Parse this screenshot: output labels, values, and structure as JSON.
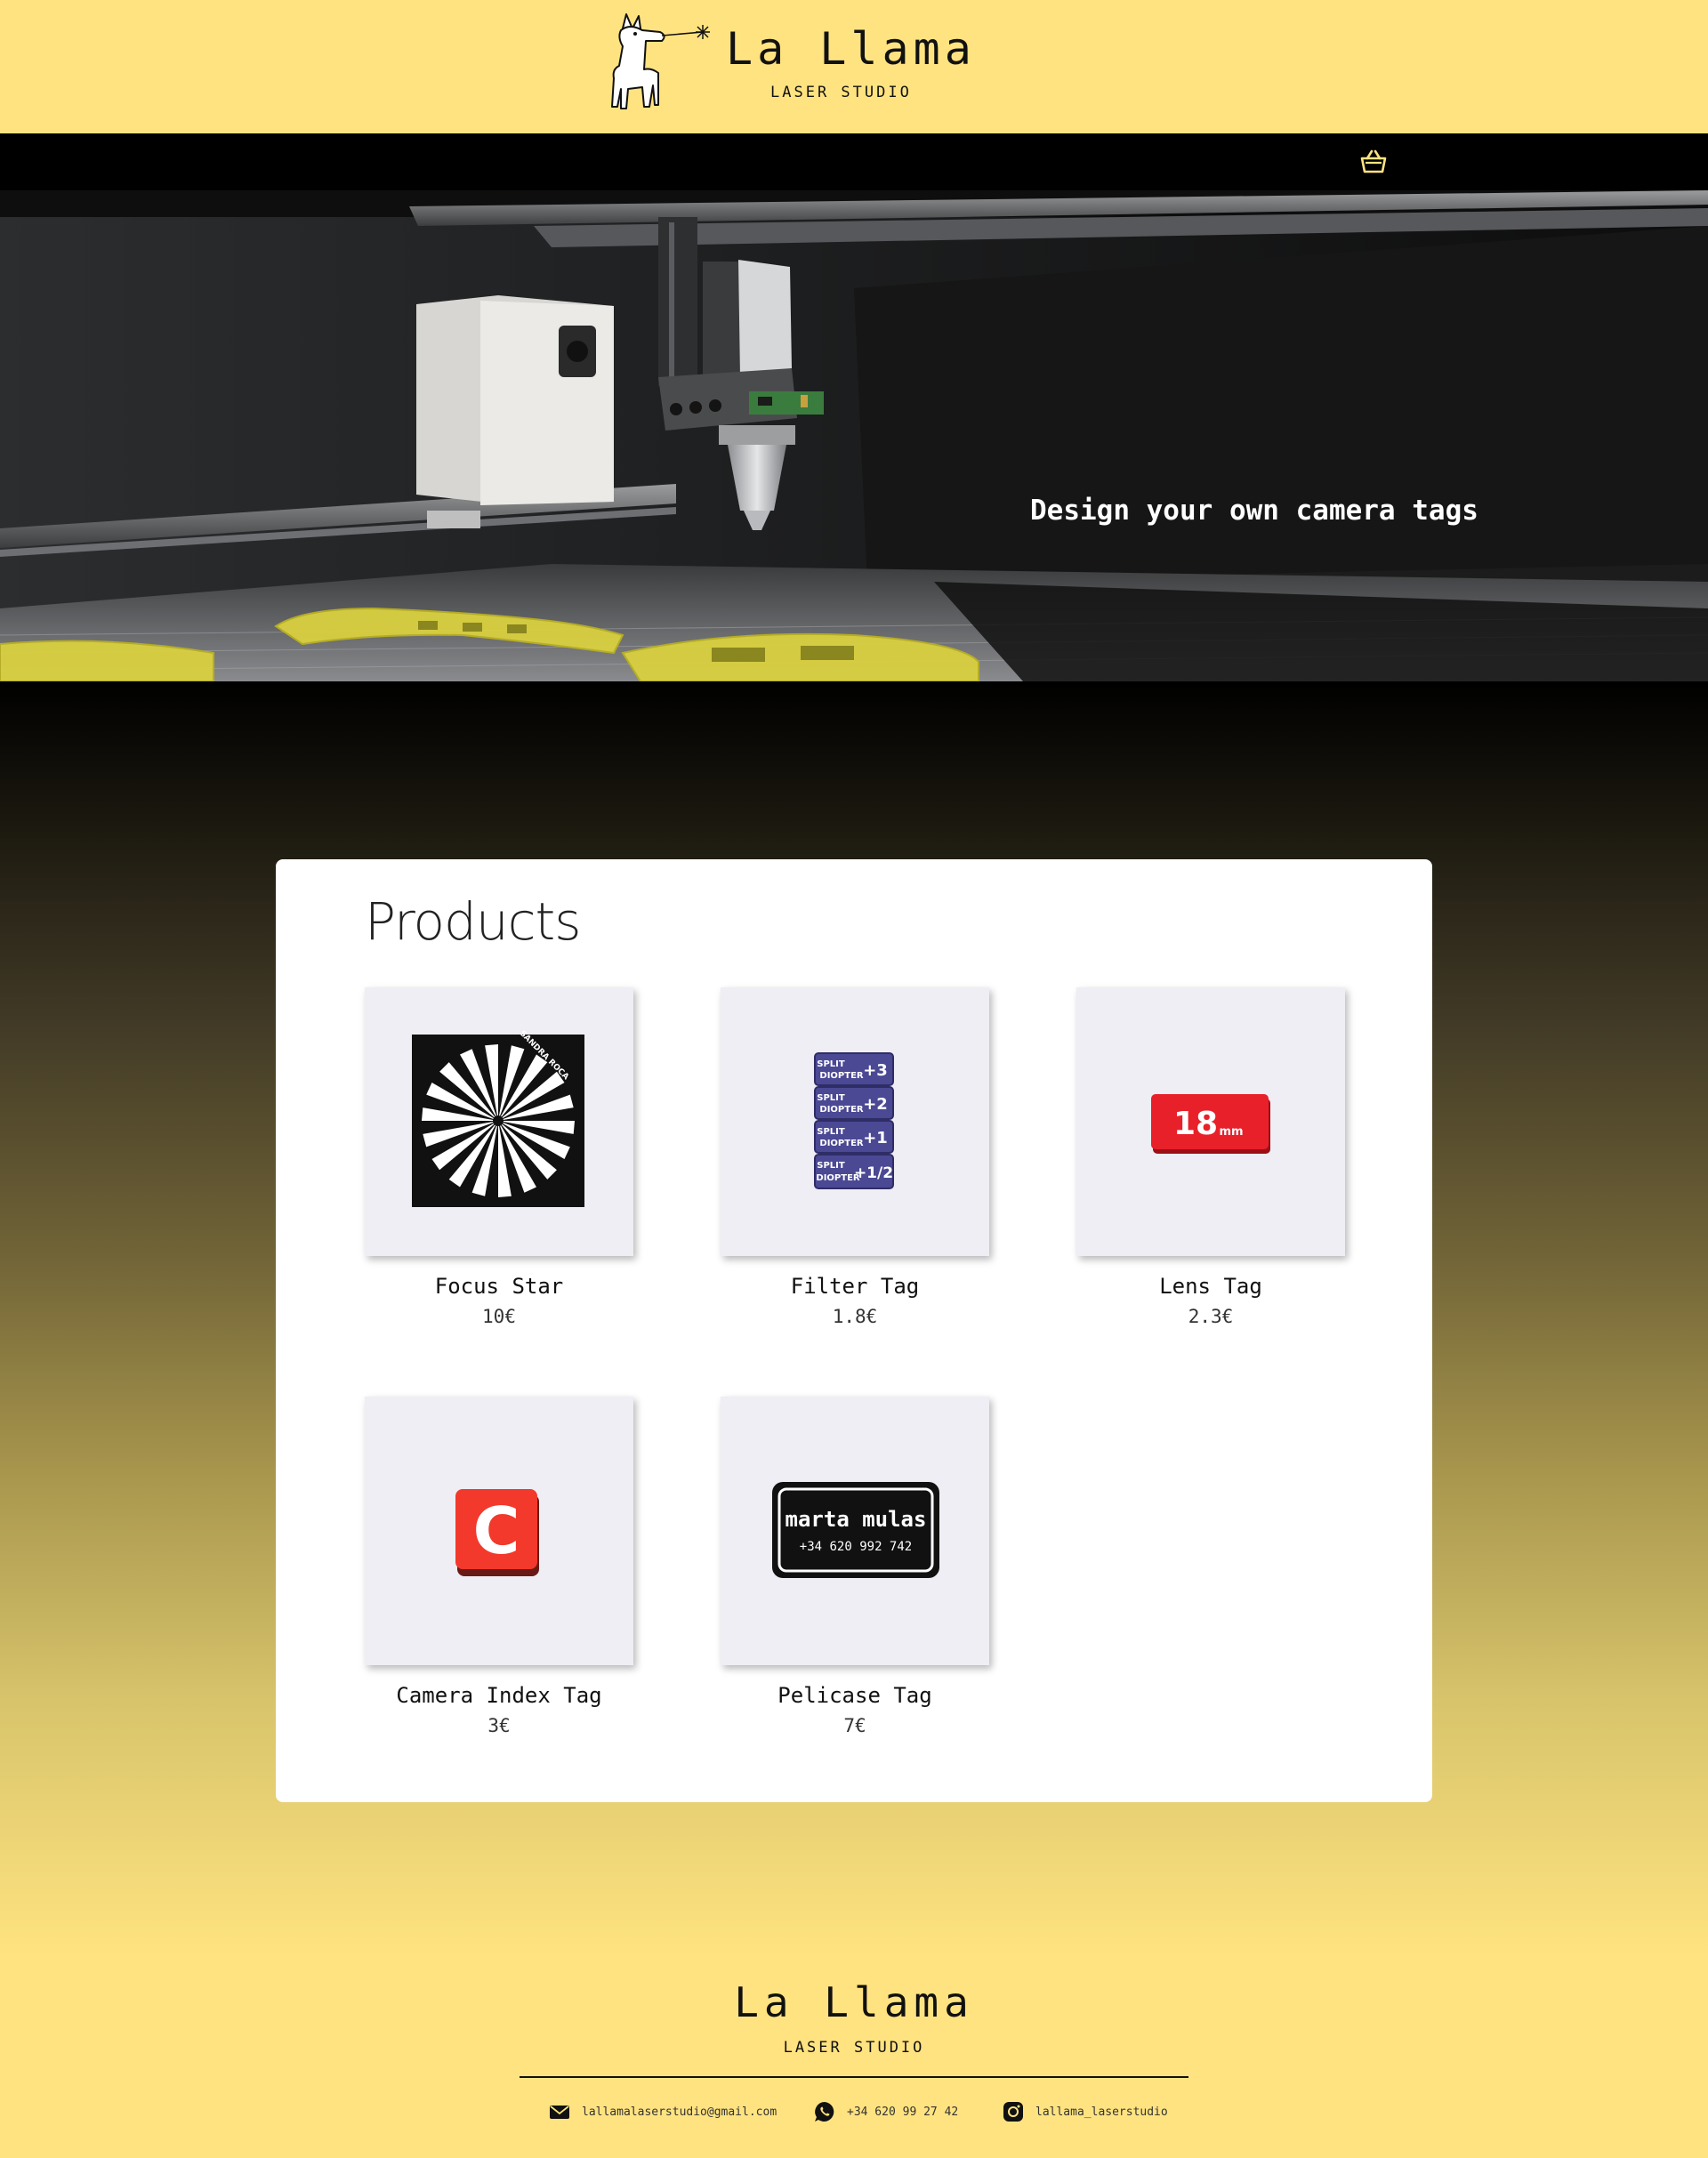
{
  "header": {
    "title": "La Llama",
    "subtitle": "LASER STUDIO",
    "logo_icon": "llama-logo-icon",
    "cart_icon": "shopping-basket-icon"
  },
  "hero": {
    "tagline": "Design your own camera tags"
  },
  "products": {
    "heading": "Products",
    "items": [
      {
        "name": "Focus Star",
        "price": "10€",
        "image": "focus-star"
      },
      {
        "name": "Filter Tag",
        "price": "1.8€",
        "image": "filter-tag"
      },
      {
        "name": "Lens Tag",
        "price": "2.3€",
        "image": "lens-tag"
      },
      {
        "name": "Camera Index Tag",
        "price": "3€",
        "image": "camera-index-tag"
      },
      {
        "name": "Pelicase Tag",
        "price": "7€",
        "image": "pelicase-tag"
      }
    ],
    "image_text": {
      "focus_star_brand": "SANDRA ROCA",
      "filter_split": "SPLIT",
      "filter_diopter": "DIOPTER",
      "filter_values": [
        "+3",
        "+2",
        "+1",
        "+1/2"
      ],
      "lens_value": "18",
      "lens_unit": "mm",
      "camera_letter": "C",
      "pelicase_name": "marta mulas",
      "pelicase_phone": "+34 620 992 742"
    }
  },
  "footer": {
    "title": "La Llama",
    "subtitle": "LASER STUDIO",
    "email": "lallamalaserstudio@gmail.com",
    "phone": "+34 620 99 27 42",
    "instagram": "lallama_laserstudio"
  },
  "colors": {
    "brand_yellow": "#ffe380",
    "navbar": "#000000",
    "tag_purple": "#4b4894",
    "tag_red": "#e8202a",
    "camera_red": "#f2392b"
  }
}
